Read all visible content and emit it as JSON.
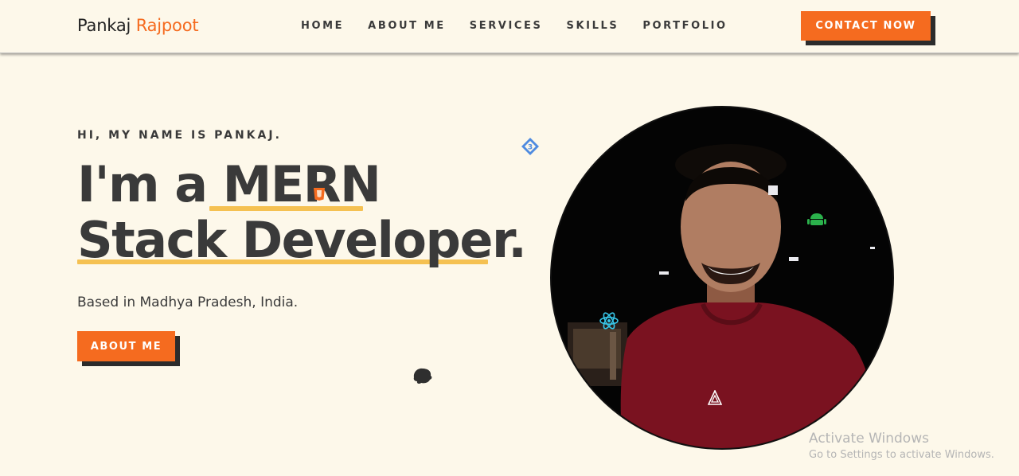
{
  "nav": {
    "brand_first": "Pankaj",
    "brand_last": "Rajpoot",
    "links": [
      "HOME",
      "ABOUT ME",
      "SERVICES",
      "SKILLS",
      "PORTFOLIO"
    ],
    "cta": "CONTACT NOW"
  },
  "hero": {
    "greeting": "HI, MY NAME IS PANKAJ.",
    "title_line1": "I'm a MERN",
    "title_line2": "Stack Developer.",
    "subtitle": "Based in Madhya Pradesh, India.",
    "button": "ABOUT ME"
  },
  "floating_icons": [
    "css3-icon",
    "html5-icon",
    "react-icon",
    "android-icon",
    "nodejs-icon",
    "mongodb-icon"
  ],
  "watermark": {
    "title": "Activate Windows",
    "subtitle": "Go to Settings to activate Windows."
  },
  "colors": {
    "background": "#fdf8ea",
    "accent": "#f56b1f",
    "underline": "#f5c152",
    "text": "#3a3a3a"
  }
}
